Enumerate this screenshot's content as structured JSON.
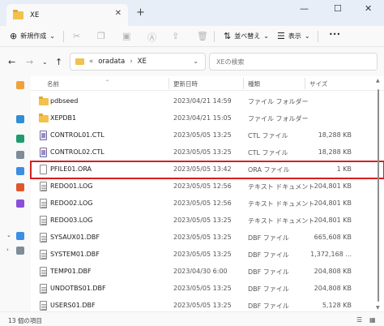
{
  "tab": {
    "title": "XE",
    "close": "✕",
    "new": "+"
  },
  "window": {
    "minimize": "—",
    "maximize": "☐",
    "close": "✕"
  },
  "toolbar": {
    "new_label": "新規作成",
    "sort_label": "並べ替え",
    "view_label": "表示",
    "more": "•••"
  },
  "address": {
    "crumbs": [
      "«",
      "oradata",
      "›",
      "XE"
    ],
    "chevron": "⌄"
  },
  "search": {
    "placeholder": "XEの検索"
  },
  "columns": {
    "name": "名前",
    "date": "更新日時",
    "type": "種類",
    "size": "サイズ"
  },
  "files": [
    {
      "name": "pdbseed",
      "date": "2023/04/21 14:59",
      "type": "ファイル フォルダー",
      "size": "",
      "icon": "folder-icon"
    },
    {
      "name": "XEPDB1",
      "date": "2023/04/21 15:05",
      "type": "ファイル フォルダー",
      "size": "",
      "icon": "folder-icon"
    },
    {
      "name": "CONTROL01.CTL",
      "date": "2023/05/05 13:25",
      "type": "CTL ファイル",
      "size": "18,288 KB",
      "icon": "ctl-file-icon"
    },
    {
      "name": "CONTROL02.CTL",
      "date": "2023/05/05 13:25",
      "type": "CTL ファイル",
      "size": "18,288 KB",
      "icon": "ctl-file-icon"
    },
    {
      "name": "PFILE01.ORA",
      "date": "2023/05/05 13:42",
      "type": "ORA ファイル",
      "size": "1 KB",
      "icon": "file-icon",
      "selected": true
    },
    {
      "name": "REDO01.LOG",
      "date": "2023/05/05 12:56",
      "type": "テキスト ドキュメント",
      "size": "204,801 KB",
      "icon": "text-file-icon"
    },
    {
      "name": "REDO02.LOG",
      "date": "2023/05/05 12:56",
      "type": "テキスト ドキュメント",
      "size": "204,801 KB",
      "icon": "text-file-icon"
    },
    {
      "name": "REDO03.LOG",
      "date": "2023/05/05 13:25",
      "type": "テキスト ドキュメント",
      "size": "204,801 KB",
      "icon": "text-file-icon"
    },
    {
      "name": "SYSAUX01.DBF",
      "date": "2023/05/05 13:25",
      "type": "DBF ファイル",
      "size": "665,608 KB",
      "icon": "dbf-file-icon"
    },
    {
      "name": "SYSTEM01.DBF",
      "date": "2023/05/05 13:25",
      "type": "DBF ファイル",
      "size": "1,372,168 ...",
      "icon": "dbf-file-icon"
    },
    {
      "name": "TEMP01.DBF",
      "date": "2023/04/30 6:00",
      "type": "DBF ファイル",
      "size": "204,808 KB",
      "icon": "dbf-file-icon"
    },
    {
      "name": "UNDOTBS01.DBF",
      "date": "2023/05/05 13:25",
      "type": "DBF ファイル",
      "size": "204,808 KB",
      "icon": "dbf-file-icon"
    },
    {
      "name": "USERS01.DBF",
      "date": "2023/05/05 13:25",
      "type": "DBF ファイル",
      "size": "5,128 KB",
      "icon": "dbf-file-icon"
    }
  ],
  "status": {
    "count": "13 個の項目"
  },
  "colors": {
    "selection_outline": "#d41f1f",
    "folder": "#f2c14e"
  }
}
